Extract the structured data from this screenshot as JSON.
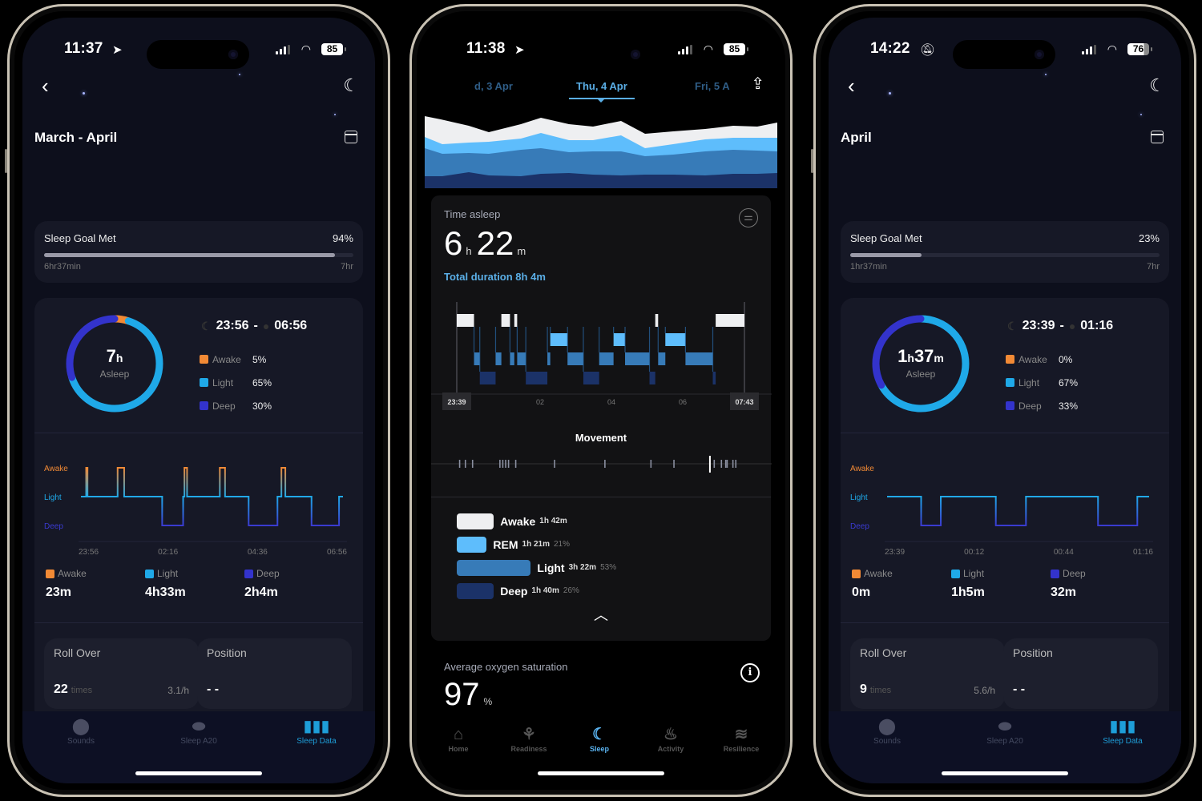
{
  "colors": {
    "awake": "#f28a35",
    "light": "#1fa9e8",
    "deep": "#3333cc",
    "accent": "#1e9ed8",
    "oura_awake": "#eeeff1",
    "oura_rem": "#5ebdfc",
    "oura_light": "#377bb8",
    "oura_deep": "#1b3268"
  },
  "phones": [
    {
      "status": {
        "time": "11:37",
        "time_icon": "location-arrow-icon",
        "battery": "85"
      },
      "header": {
        "back_icon": "chevron-left-icon",
        "settings_icon": "moon-gear-icon",
        "title": "March - April",
        "calendar_icon": "calendar-icon"
      },
      "goal": {
        "label": "Sleep Goal Met",
        "percent_text": "94%",
        "progress": 0.94,
        "from": "6hr37min",
        "to": "7hr"
      },
      "ring": {
        "hours": "7",
        "unit": "h",
        "label": "Asleep",
        "segments": {
          "awake": 0.05,
          "light": 0.65,
          "deep": 0.3
        }
      },
      "window": {
        "start": "23:56",
        "sep": "-",
        "end": "06:56"
      },
      "legend": [
        {
          "name": "Awake",
          "value": "5%"
        },
        {
          "name": "Light",
          "value": "65%"
        },
        {
          "name": "Deep",
          "value": "30%"
        }
      ],
      "hypnogram": {
        "y_labels": [
          "Awake",
          "Light",
          "Deep"
        ],
        "x_labels": [
          "23:56",
          "02:16",
          "04:36",
          "06:56"
        ],
        "steps": [
          [
            0,
            1
          ],
          [
            0.02,
            0
          ],
          [
            0.025,
            1
          ],
          [
            0.14,
            0
          ],
          [
            0.165,
            1
          ],
          [
            0.31,
            2
          ],
          [
            0.39,
            1
          ],
          [
            0.395,
            0
          ],
          [
            0.405,
            1
          ],
          [
            0.53,
            0
          ],
          [
            0.55,
            1
          ],
          [
            0.64,
            2
          ],
          [
            0.75,
            1
          ],
          [
            0.765,
            0
          ],
          [
            0.78,
            1
          ],
          [
            0.88,
            2
          ],
          [
            0.985,
            1
          ],
          [
            1,
            1
          ]
        ]
      },
      "totals": [
        {
          "name": "Awake",
          "value": "23m"
        },
        {
          "name": "Light",
          "value": "4h33m"
        },
        {
          "name": "Deep",
          "value": "2h4m"
        }
      ],
      "rollover": {
        "title": "Roll Over",
        "count": "22",
        "unit": "times",
        "rate": "3.1/h"
      },
      "position": {
        "title": "Position",
        "value": "- -"
      },
      "tabs": [
        {
          "label": "Sounds",
          "icon": "sounds-icon"
        },
        {
          "label": "Sleep A20",
          "icon": "sleep-device-icon"
        },
        {
          "label": "Sleep Data",
          "icon": "bar-chart-icon",
          "active": true
        }
      ]
    },
    {
      "status": {
        "time": "11:38",
        "time_icon": "location-arrow-icon",
        "battery": "85"
      },
      "dates": {
        "prev": "d, 3 Apr",
        "current": "Thu, 4 Apr",
        "next": "Fri, 5 A"
      },
      "share_icon": "share-icon",
      "time_asleep": {
        "label": "Time asleep",
        "hours": "6",
        "h_unit": "h",
        "minutes": "22",
        "m_unit": "m",
        "total": "Total duration 8h 4m"
      },
      "hypnogram": {
        "start": "23:39",
        "end": "07:43",
        "ticks": [
          "02",
          "04",
          "06"
        ],
        "segments": [
          [
            0,
            0.06,
            "awake"
          ],
          [
            0.06,
            0.08,
            "light"
          ],
          [
            0.08,
            0.135,
            "deep"
          ],
          [
            0.135,
            0.155,
            "light"
          ],
          [
            0.155,
            0.185,
            "awake"
          ],
          [
            0.185,
            0.2,
            "light"
          ],
          [
            0.2,
            0.21,
            "awake"
          ],
          [
            0.21,
            0.24,
            "light"
          ],
          [
            0.24,
            0.315,
            "deep"
          ],
          [
            0.315,
            0.325,
            "light"
          ],
          [
            0.325,
            0.385,
            "rem"
          ],
          [
            0.385,
            0.44,
            "light"
          ],
          [
            0.44,
            0.495,
            "deep"
          ],
          [
            0.495,
            0.545,
            "light"
          ],
          [
            0.545,
            0.585,
            "rem"
          ],
          [
            0.585,
            0.67,
            "light"
          ],
          [
            0.67,
            0.69,
            "deep"
          ],
          [
            0.69,
            0.7,
            "awake"
          ],
          [
            0.7,
            0.725,
            "light"
          ],
          [
            0.725,
            0.795,
            "rem"
          ],
          [
            0.795,
            0.89,
            "light"
          ],
          [
            0.89,
            0.9,
            "deep"
          ],
          [
            0.9,
            1,
            "awake"
          ]
        ]
      },
      "movement": {
        "title": "Movement",
        "events": [
          0.01,
          0.03,
          0.055,
          0.15,
          0.16,
          0.17,
          0.18,
          0.205,
          0.34,
          0.515,
          0.675,
          0.755,
          0.88,
          0.895,
          0.92,
          0.935,
          0.94,
          0.96,
          0.97
        ]
      },
      "stages": [
        {
          "key": "awake",
          "name": "Awake",
          "duration": "1h 42m",
          "percent": "",
          "share": 0.21
        },
        {
          "key": "rem",
          "name": "REM",
          "duration": "1h 21m",
          "percent": "21%",
          "share": 0.17
        },
        {
          "key": "light",
          "name": "Light",
          "duration": "3h 22m",
          "percent": "53%",
          "share": 0.42
        },
        {
          "key": "deep",
          "name": "Deep",
          "duration": "1h 40m",
          "percent": "26%",
          "share": 0.21
        }
      ],
      "collapse_icon": "chevron-up-icon",
      "filter_icon": "sliders-icon",
      "oxygen": {
        "label": "Average oxygen saturation",
        "value": "97",
        "unit": "%",
        "info_icon": "info-icon"
      },
      "tabs": [
        {
          "label": "Home",
          "icon": "home-icon"
        },
        {
          "label": "Readiness",
          "icon": "sprout-icon"
        },
        {
          "label": "Sleep",
          "icon": "moon-icon",
          "active": true
        },
        {
          "label": "Activity",
          "icon": "flame-icon"
        },
        {
          "label": "Resilience",
          "icon": "waves-icon"
        }
      ]
    },
    {
      "status": {
        "time": "14:22",
        "time_icon": "bell-slash-icon",
        "battery": "76"
      },
      "header": {
        "back_icon": "chevron-left-icon",
        "settings_icon": "moon-gear-icon",
        "title": "April",
        "calendar_icon": "calendar-icon"
      },
      "goal": {
        "label": "Sleep Goal Met",
        "percent_text": "23%",
        "progress": 0.23,
        "from": "1hr37min",
        "to": "7hr"
      },
      "ring": {
        "hours": "1",
        "unit": "h",
        "minutes": "37",
        "m_unit": "m",
        "label": "Asleep",
        "segments": {
          "awake": 0.0,
          "light": 0.67,
          "deep": 0.33
        }
      },
      "window": {
        "start": "23:39",
        "sep": "-",
        "end": "01:16"
      },
      "legend": [
        {
          "name": "Awake",
          "value": "0%"
        },
        {
          "name": "Light",
          "value": "67%"
        },
        {
          "name": "Deep",
          "value": "33%"
        }
      ],
      "hypnogram": {
        "y_labels": [
          "Awake",
          "Light",
          "Deep"
        ],
        "x_labels": [
          "23:39",
          "00:12",
          "00:44",
          "01:16"
        ],
        "steps": [
          [
            0,
            1
          ],
          [
            0.13,
            2
          ],
          [
            0.205,
            1
          ],
          [
            0.415,
            2
          ],
          [
            0.53,
            1
          ],
          [
            0.805,
            2
          ],
          [
            0.955,
            1
          ],
          [
            1,
            1
          ]
        ]
      },
      "totals": [
        {
          "name": "Awake",
          "value": "0m"
        },
        {
          "name": "Light",
          "value": "1h5m"
        },
        {
          "name": "Deep",
          "value": "32m"
        }
      ],
      "rollover": {
        "title": "Roll Over",
        "count": "9",
        "unit": "times",
        "rate": "5.6/h"
      },
      "position": {
        "title": "Position",
        "value": "- -"
      },
      "tabs": [
        {
          "label": "Sounds",
          "icon": "sounds-icon"
        },
        {
          "label": "Sleep A20",
          "icon": "sleep-device-icon"
        },
        {
          "label": "Sleep Data",
          "icon": "bar-chart-icon",
          "active": true
        }
      ]
    }
  ]
}
